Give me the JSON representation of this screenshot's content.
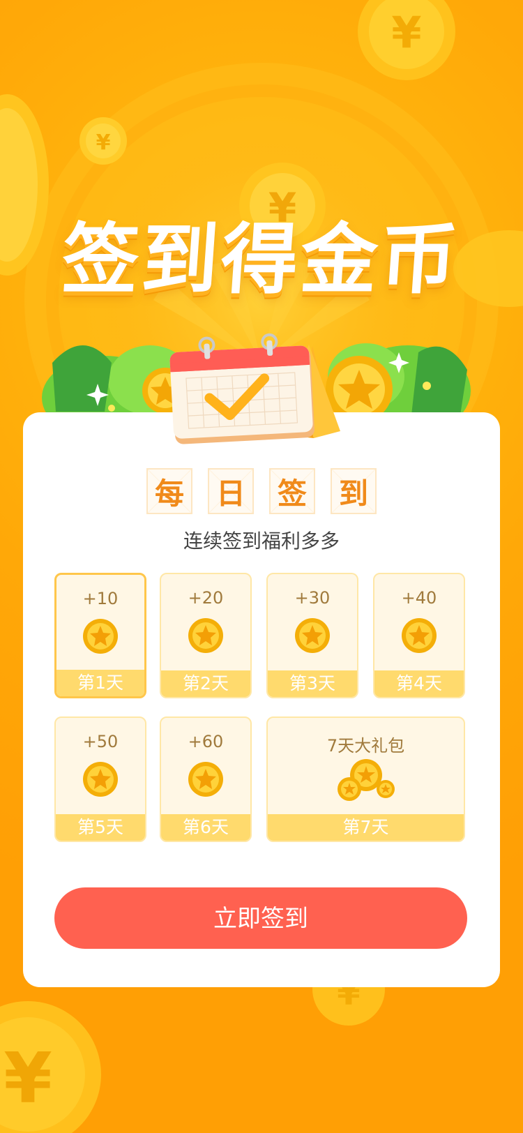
{
  "hero": {
    "title": "签到得金币"
  },
  "card": {
    "headline": [
      "每",
      "日",
      "签",
      "到"
    ],
    "subtitle": "连续签到福利多多",
    "tiles": [
      {
        "amount": "+10",
        "day": "第1天",
        "active": true
      },
      {
        "amount": "+20",
        "day": "第2天",
        "active": false
      },
      {
        "amount": "+30",
        "day": "第3天",
        "active": false
      },
      {
        "amount": "+40",
        "day": "第4天",
        "active": false
      },
      {
        "amount": "+50",
        "day": "第5天",
        "active": false
      },
      {
        "amount": "+60",
        "day": "第6天",
        "active": false
      },
      {
        "amount": "7天大礼包",
        "day": "第7天",
        "active": false
      }
    ],
    "button_label": "立即签到"
  },
  "colors": {
    "accent": "#ff6150",
    "tile_bg": "#fff7e5",
    "tile_footer": "#ffda6d",
    "headline": "#f08a1a",
    "background": "#ffaa08"
  },
  "icons": [
    "yuan-coin-icon",
    "calendar-check-icon",
    "star-coin-icon",
    "coin-pile-icon",
    "sparkle-icon"
  ]
}
